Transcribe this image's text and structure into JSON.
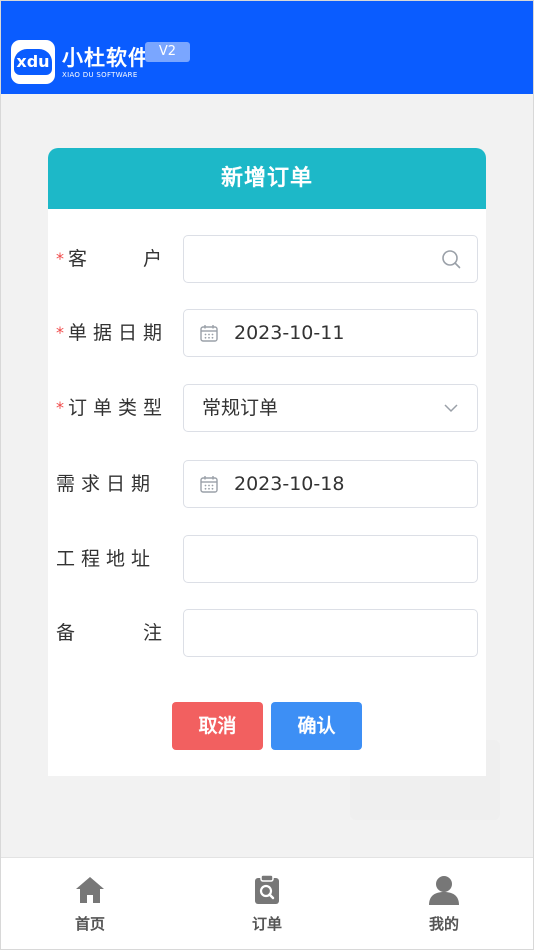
{
  "header": {
    "logo_mark": "xdu",
    "brand_name": "小杜软件",
    "brand_sub": "XIAO DU SOFTWARE",
    "version": "V2",
    "bg_color": "#0a5cff"
  },
  "form": {
    "title": "新增订单",
    "title_color": "#1db8c8",
    "fields": [
      {
        "label": "客户",
        "required": true,
        "value": "",
        "icon": "search-icon"
      },
      {
        "label": "单据日期",
        "required": true,
        "value": "2023-10-11",
        "icon": "calendar-icon"
      },
      {
        "label": "订单类型",
        "required": true,
        "value": "常规订单",
        "icon": "chevron-down-icon"
      },
      {
        "label": "需求日期",
        "required": false,
        "value": "2023-10-18",
        "icon": "calendar-icon"
      },
      {
        "label": "工程地址",
        "required": false,
        "value": ""
      },
      {
        "label": "备注",
        "required": false,
        "value": ""
      }
    ],
    "required_mark": "*",
    "cancel_label": "取消",
    "confirm_label": "确认",
    "cancel_color": "#f26060",
    "confirm_color": "#3d8ff5"
  },
  "tabbar": {
    "items": [
      {
        "label": "首页",
        "icon": "home-icon"
      },
      {
        "label": "订单",
        "icon": "order-icon"
      },
      {
        "label": "我的",
        "icon": "user-icon"
      }
    ]
  }
}
